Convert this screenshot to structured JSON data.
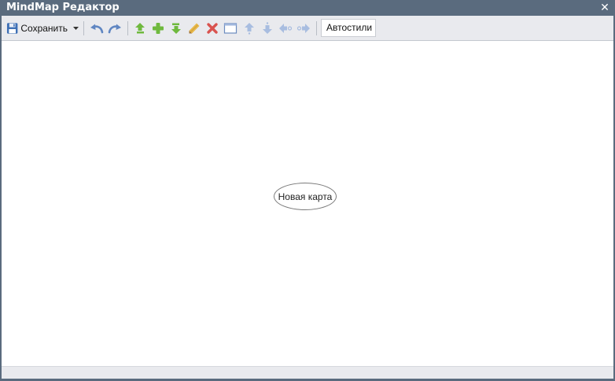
{
  "window": {
    "title": "MindMap Редактор",
    "close_glyph": "✕"
  },
  "toolbar": {
    "save_label": "Сохранить",
    "autostyles_label": "Автостили",
    "icons": [
      "save-icon",
      "dropdown-arrow-icon",
      "undo-icon",
      "redo-icon",
      "add-parent-icon",
      "add-child-icon",
      "add-sibling-icon",
      "edit-icon",
      "delete-icon",
      "frame-icon",
      "move-up-icon",
      "move-down-icon",
      "move-left-icon",
      "move-right-icon"
    ]
  },
  "map": {
    "root_node": "Новая карта"
  },
  "colors": {
    "titlebar": "#5a6b7e",
    "toolbar": "#e9eaee",
    "canvas": "#ffffff",
    "green_accent": "#6fb93e",
    "red_accent": "#d9534f",
    "blue_accent": "#5f86c2"
  }
}
